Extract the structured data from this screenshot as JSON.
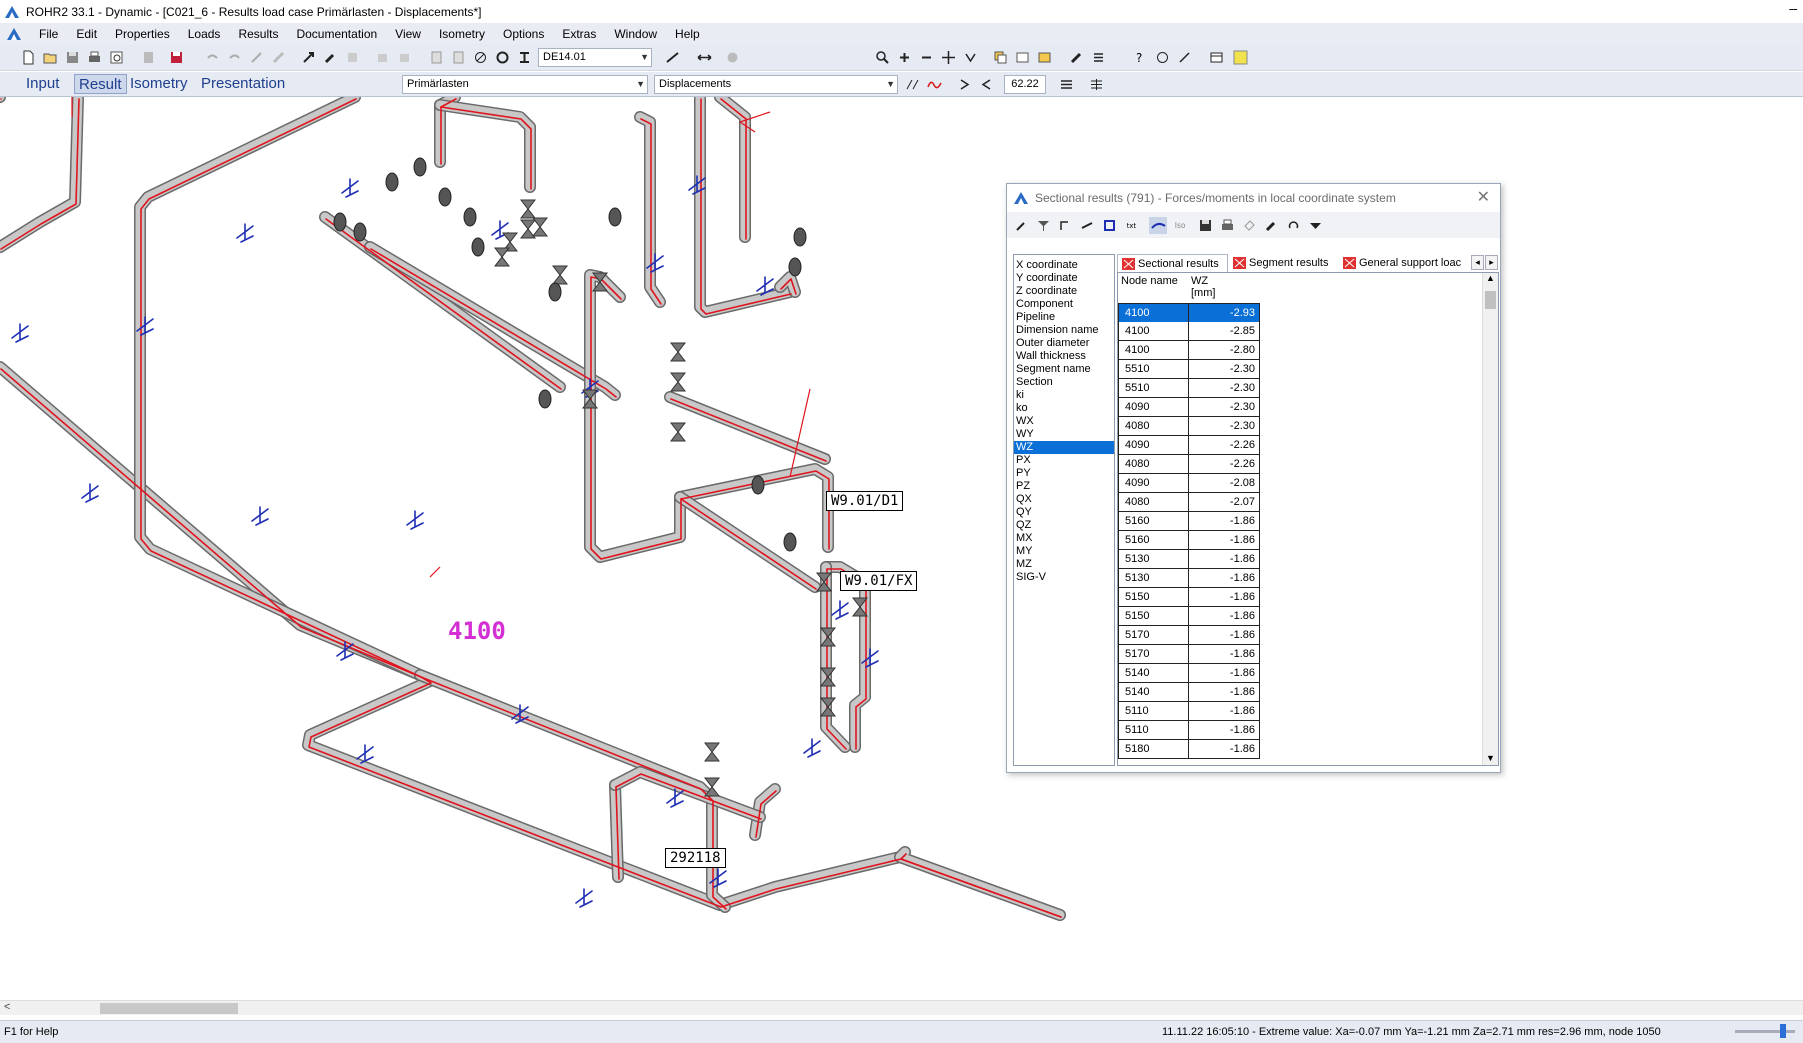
{
  "window": {
    "title": "ROHR2 33.1 - Dynamic - [C021_6 - Results load case Primärlasten - Displacements*]",
    "minimize_glyph": "–"
  },
  "menu": [
    "File",
    "Edit",
    "Properties",
    "Loads",
    "Results",
    "Documentation",
    "View",
    "Isometry",
    "Options",
    "Extras",
    "Window",
    "Help"
  ],
  "toolbar": {
    "view_combo": "DE14.01"
  },
  "modebar": {
    "tabs": [
      {
        "label": "Input",
        "active": false
      },
      {
        "label": "Result",
        "active": true
      },
      {
        "label": "Isometry",
        "active": false
      },
      {
        "label": "Presentation",
        "active": false
      }
    ],
    "loadcase_combo": "Primärlasten",
    "result_combo": "Displacements",
    "zoom_value": "62.22"
  },
  "canvas": {
    "big_node_label": "4100",
    "labels": [
      "W9.01/D1",
      "W9.01/FX",
      "292118"
    ]
  },
  "dialog": {
    "title": "Sectional results (791) - Forces/moments in local coordinate system",
    "close_glyph": "✕",
    "fields": [
      "X coordinate",
      "Y coordinate",
      "Z coordinate",
      "Component",
      "Pipeline",
      "Dimension name",
      "Outer diameter",
      "Wall thickness",
      "Segment name",
      "Section",
      "ki",
      "ko",
      "WX",
      "WY",
      "WZ",
      "PX",
      "PY",
      "PZ",
      "QX",
      "QY",
      "QZ",
      "MX",
      "MY",
      "MZ",
      "SIG-V"
    ],
    "selected_field": "WZ",
    "tabs": [
      "Sectional results",
      "Segment results",
      "General support loac"
    ],
    "active_tab": "Sectional results",
    "grid": {
      "col1": "Node name",
      "col2_line1": "WZ",
      "col2_line2": "[mm]",
      "rows": [
        [
          "4100",
          "-2.93"
        ],
        [
          "4100",
          "-2.85"
        ],
        [
          "4100",
          "-2.80"
        ],
        [
          "5510",
          "-2.30"
        ],
        [
          "5510",
          "-2.30"
        ],
        [
          "4090",
          "-2.30"
        ],
        [
          "4080",
          "-2.30"
        ],
        [
          "4090",
          "-2.26"
        ],
        [
          "4080",
          "-2.26"
        ],
        [
          "4090",
          "-2.08"
        ],
        [
          "4080",
          "-2.07"
        ],
        [
          "5160",
          "-1.86"
        ],
        [
          "5160",
          "-1.86"
        ],
        [
          "5130",
          "-1.86"
        ],
        [
          "5130",
          "-1.86"
        ],
        [
          "5150",
          "-1.86"
        ],
        [
          "5150",
          "-1.86"
        ],
        [
          "5170",
          "-1.86"
        ],
        [
          "5170",
          "-1.86"
        ],
        [
          "5140",
          "-1.86"
        ],
        [
          "5140",
          "-1.86"
        ],
        [
          "5110",
          "-1.86"
        ],
        [
          "5110",
          "-1.86"
        ],
        [
          "5180",
          "-1.86"
        ]
      ]
    }
  },
  "statusbar": {
    "help": "F1 for Help",
    "info": "11.11.22  16:05:10 - Extreme value: Xa=-0.07 mm Ya=-1.21 mm Za=2.71 mm res=2.96 mm, node 1050"
  },
  "colors": {
    "pipe": "#c8c8c8",
    "pipe_outline": "#6a6a6a",
    "deformed": "#e0141e",
    "support": "#1f2fb3",
    "selection": "#0a6fd6",
    "node_highlight": "#d42fd4"
  }
}
